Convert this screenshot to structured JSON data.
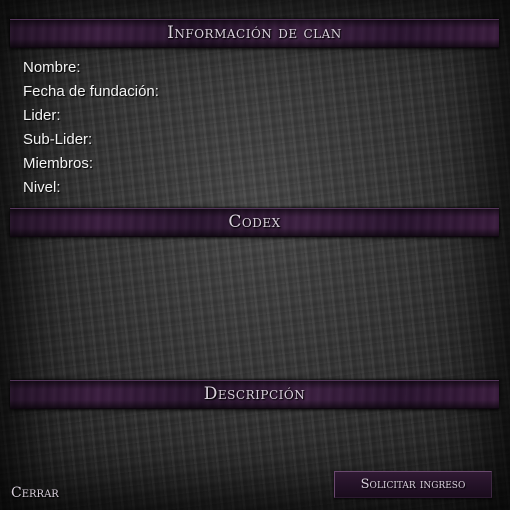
{
  "window": {
    "sections": {
      "info_title": "Información de clan",
      "codex_title": "Codex",
      "description_title": "Descripción"
    },
    "info_fields": [
      "Nombre:",
      "Fecha de fundación:",
      "Lider:",
      "Sub-Lider:",
      "Miembros:",
      "Nivel:"
    ],
    "codex_text": "",
    "description_text": "",
    "buttons": {
      "close_label": "Cerrar",
      "request_label": "Solicitar ingreso"
    }
  },
  "colors": {
    "banner": "#3a1d3f",
    "title_text": "#d9d0dc",
    "field_text": "#f3f3f3",
    "stone_background": "#2c2c2c"
  }
}
